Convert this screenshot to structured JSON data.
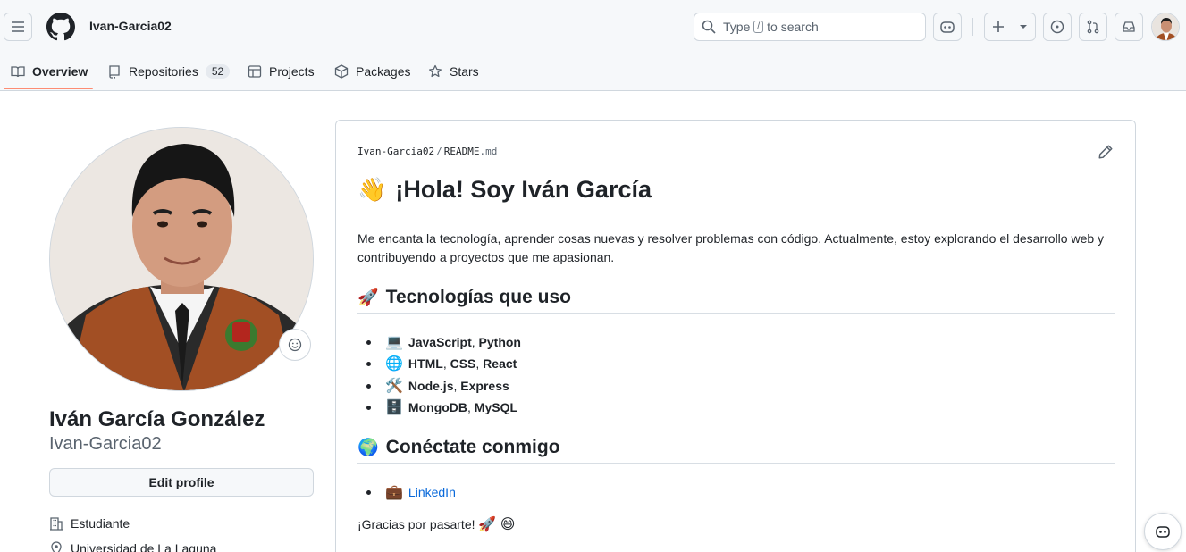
{
  "header": {
    "owner": "Ivan-Garcia02",
    "search": {
      "before": "Type",
      "key": "/",
      "after": "to search"
    }
  },
  "tabs": [
    {
      "label": "Overview",
      "icon": "book-icon"
    },
    {
      "label": "Repositories",
      "icon": "repo-icon",
      "count": "52"
    },
    {
      "label": "Projects",
      "icon": "table-icon"
    },
    {
      "label": "Packages",
      "icon": "package-icon"
    },
    {
      "label": "Stars",
      "icon": "star-icon"
    }
  ],
  "profile": {
    "fullname": "Iván García González",
    "login": "Ivan-Garcia02",
    "edit_label": "Edit profile",
    "company": "Estudiante",
    "location": "Universidad de La Laguna"
  },
  "readme": {
    "crumb_owner": "Ivan-Garcia02",
    "crumb_sep": "/",
    "crumb_file": "README",
    "crumb_ext": ".md",
    "title_emoji": "👋",
    "title": "¡Hola! Soy Iván García",
    "intro": "Me encanta la tecnología, aprender cosas nuevas y resolver problemas con código. Actualmente, estoy explorando el desarrollo web y contribuyendo a proyectos que me apasionan.",
    "tech_emoji": "🚀",
    "tech_heading": "Tecnologías que uso",
    "tech_items": [
      {
        "emoji": "💻",
        "a": "JavaScript",
        "sep": ", ",
        "b": "Python"
      },
      {
        "emoji": "🌐",
        "a": "HTML",
        "sep": ", ",
        "b": "CSS",
        "sep2": ", ",
        "c": "React"
      },
      {
        "emoji": "🛠️",
        "a": "Node.js",
        "sep": ", ",
        "b": "Express"
      },
      {
        "emoji": "🗄️",
        "a": "MongoDB",
        "sep": ", ",
        "b": "MySQL"
      }
    ],
    "connect_emoji": "🌍",
    "connect_heading": "Conéctate conmigo",
    "link_emoji": "💼",
    "link_label": "LinkedIn",
    "outro": "¡Gracias por pasarte!",
    "outro_emoji": "🚀 😄"
  },
  "colors": {
    "accent_tab": "#fd8c73",
    "link": "#0969da",
    "text": "#1f2328",
    "muted": "#59636e"
  }
}
